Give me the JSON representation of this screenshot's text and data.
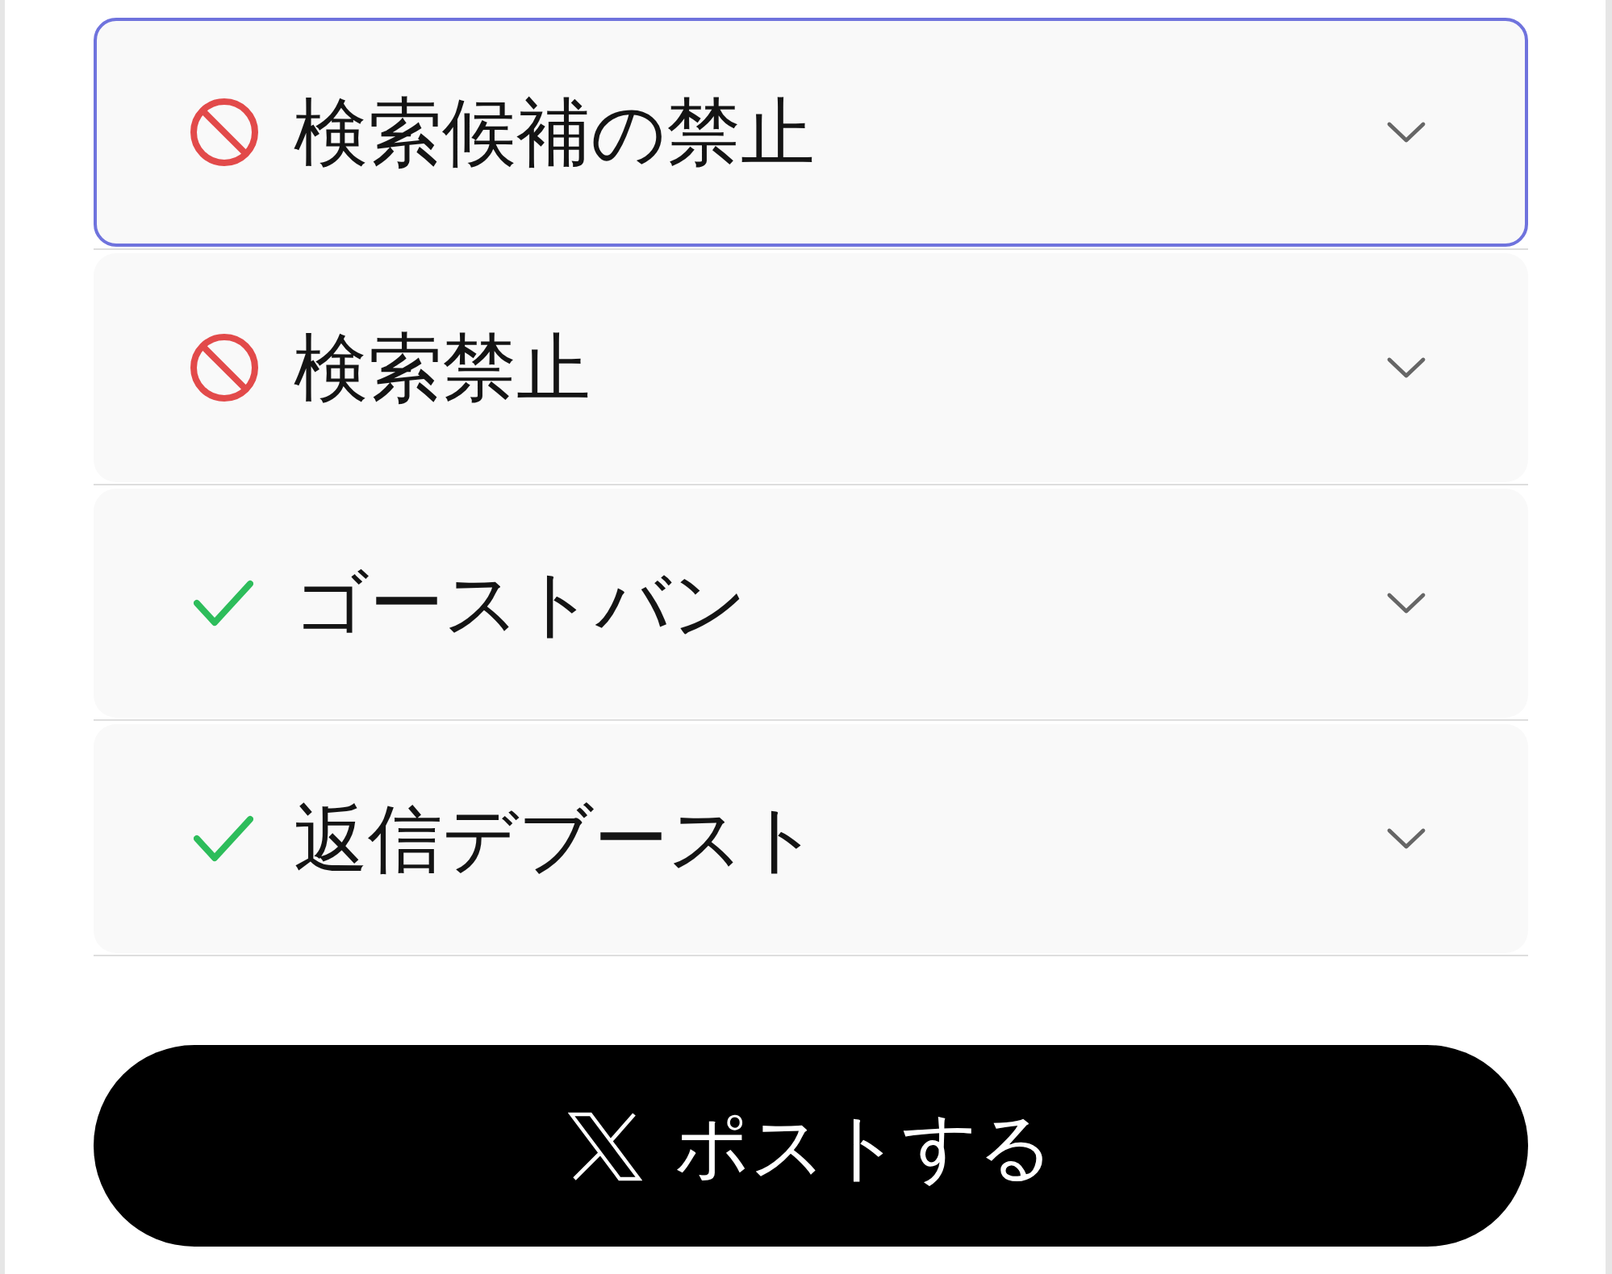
{
  "checks": [
    {
      "kind": "blocked",
      "label": "検索候補の禁止",
      "selected": true,
      "expanded": false
    },
    {
      "kind": "blocked",
      "label": "検索禁止",
      "selected": false,
      "expanded": false
    },
    {
      "kind": "passed",
      "label": "ゴーストバン",
      "selected": false,
      "expanded": false
    },
    {
      "kind": "passed",
      "label": "返信デブースト",
      "selected": false,
      "expanded": false
    }
  ],
  "post_button": {
    "label": "ポストする"
  }
}
